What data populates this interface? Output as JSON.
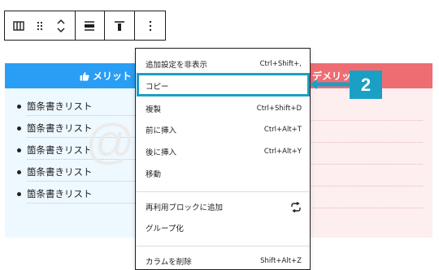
{
  "toolbar": {
    "block_icon": "columns-icon",
    "drag_icon": "drag-handle-icon",
    "move_icon": "move-up-down-icon",
    "align_icon": "align-center-icon",
    "valign_icon": "align-top-icon",
    "more_icon": "more-vertical-icon"
  },
  "columns": {
    "left": {
      "header": "メリット",
      "header_icon": "thumbs-up-icon",
      "header_color": "#2a9df4",
      "items": [
        "箇条書きリスト",
        "箇条書きリスト",
        "箇条書きリスト",
        "箇条書きリスト",
        "箇条書きリスト"
      ]
    },
    "right": {
      "header": "デメリット",
      "header_color": "#ee6d73"
    }
  },
  "watermark": "@kidata",
  "menu": {
    "items": [
      {
        "label": "追加設定を非表示",
        "shortcut": "Ctrl+Shift+,"
      },
      {
        "label": "コピー",
        "shortcut": ""
      },
      {
        "label": "複製",
        "shortcut": "Ctrl+Shift+D"
      },
      {
        "label": "前に挿入",
        "shortcut": "Ctrl+Alt+T"
      },
      {
        "label": "後に挿入",
        "shortcut": "Ctrl+Alt+Y"
      },
      {
        "label": "移動",
        "shortcut": ""
      },
      {
        "label": "再利用ブロックに追加",
        "shortcut": "",
        "icon": "reusable-block-icon"
      },
      {
        "label": "グループ化",
        "shortcut": ""
      },
      {
        "label": "カラムを削除",
        "shortcut": "Shift+Alt+Z"
      }
    ]
  },
  "annotation": {
    "number": "2",
    "color": "#1aa0c4"
  }
}
